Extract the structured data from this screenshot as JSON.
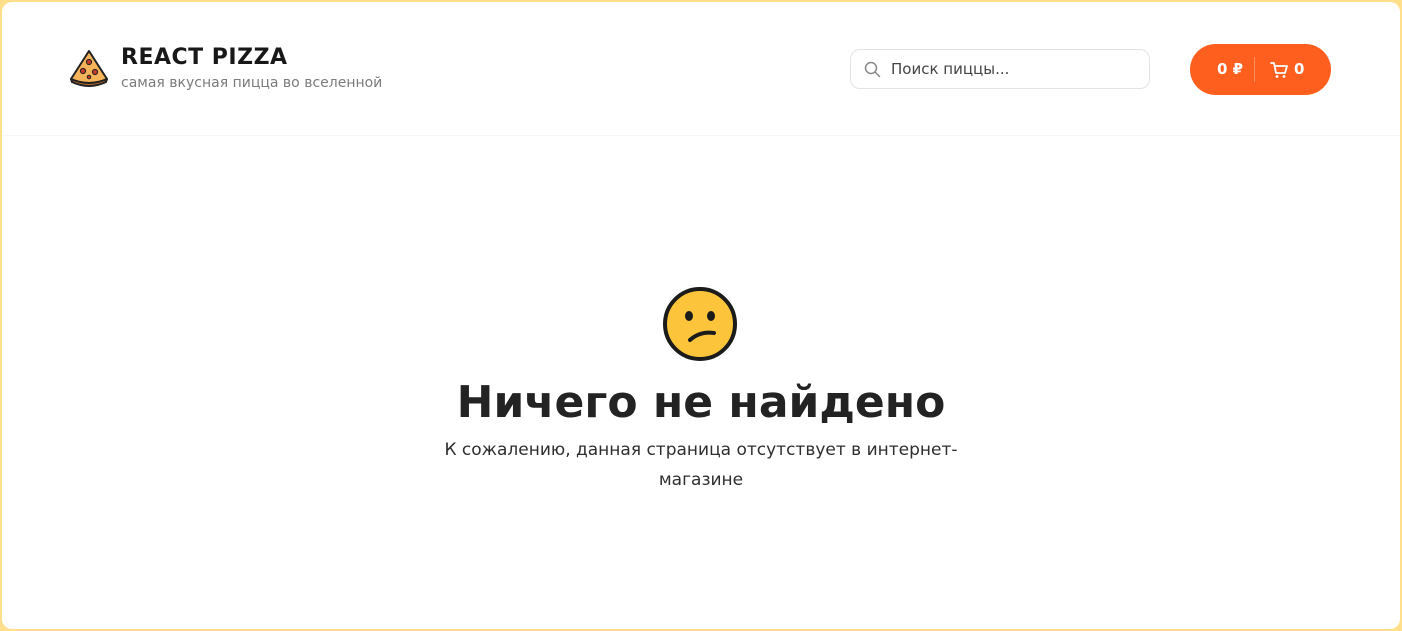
{
  "header": {
    "logo_title": "REACT PIZZA",
    "logo_subtitle": "самая вкусная пицца во вселенной",
    "search_placeholder": "Поиск пиццы...",
    "cart_price": "0 ₽",
    "cart_count": "0",
    "accent_color": "#fe5f1e"
  },
  "not_found": {
    "emoji": "confused-face-emoji",
    "title": "Ничего не найдено",
    "description": "К сожалению, данная страница отсутствует в интернет-магазине"
  },
  "colors": {
    "page_background": "#ffdf8c",
    "card_background": "#ffffff"
  }
}
